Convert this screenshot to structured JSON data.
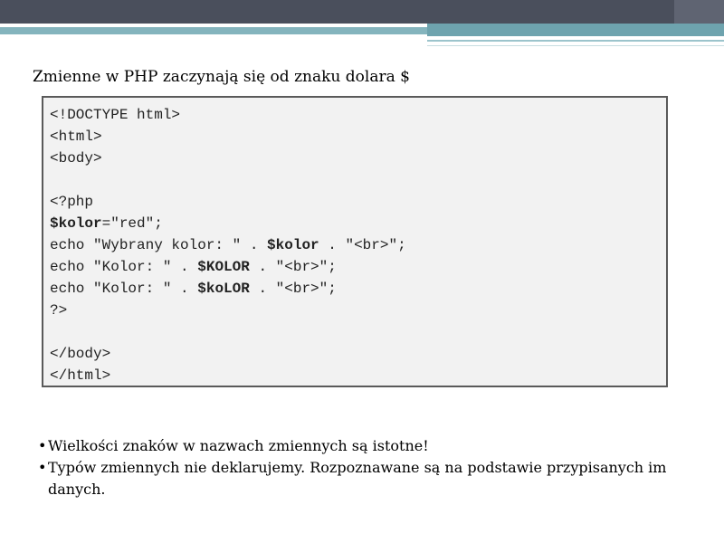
{
  "heading": "Zmienne w PHP zaczynają się od znaku dolara $",
  "code_lines": [
    [
      {
        "t": "<!DOCTYPE html>"
      }
    ],
    [
      {
        "t": "<html>"
      }
    ],
    [
      {
        "t": "<body>"
      }
    ],
    [
      {
        "t": ""
      }
    ],
    [
      {
        "t": "<?php"
      }
    ],
    [
      {
        "t": "$kolor",
        "b": true
      },
      {
        "t": "=\"red\";"
      }
    ],
    [
      {
        "t": "echo \"Wybrany kolor: \" . "
      },
      {
        "t": "$kolor",
        "b": true
      },
      {
        "t": " . \"<br>\";"
      }
    ],
    [
      {
        "t": "echo \"Kolor: \" . "
      },
      {
        "t": "$KOLOR",
        "b": true
      },
      {
        "t": " . \"<br>\";"
      }
    ],
    [
      {
        "t": "echo \"Kolor: \" . "
      },
      {
        "t": "$koLOR",
        "b": true
      },
      {
        "t": " . \"<br>\";"
      }
    ],
    [
      {
        "t": "?>"
      }
    ],
    [
      {
        "t": ""
      }
    ],
    [
      {
        "t": "</body>"
      }
    ],
    [
      {
        "t": "</html>"
      }
    ]
  ],
  "bullets": [
    "Wielkości znaków w nazwach zmiennych są istotne!",
    "Typów zmiennych nie deklarujemy. Rozpoznawane są na podstawie przypisanych im danych."
  ],
  "bullet_marker": "•"
}
